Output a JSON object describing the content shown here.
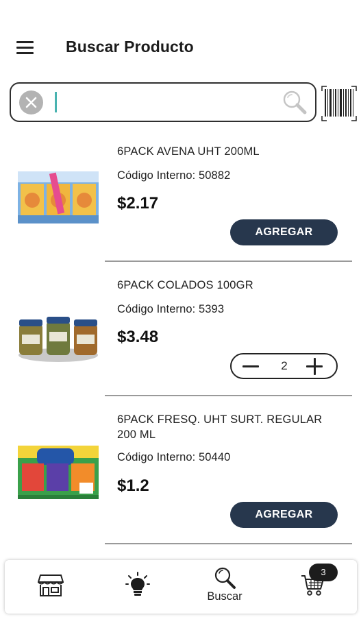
{
  "header": {
    "title": "Buscar Producto",
    "menu_icon": "hamburger-menu-icon"
  },
  "search": {
    "value": "",
    "placeholder": "",
    "clear_icon": "clear-x-icon",
    "search_icon": "magnifier-icon",
    "barcode_icon": "barcode-scanner-icon",
    "caret_color": "#49b3b0"
  },
  "products": [
    {
      "name": "6PACK AVENA UHT 200ML",
      "code_label": "Código Interno: 50882",
      "price": "$2.17",
      "action_label": "AGREGAR",
      "in_cart": false
    },
    {
      "name": "6PACK COLADOS 100GR",
      "code_label": "Código Interno: 5393",
      "price": "$3.48",
      "quantity": "2",
      "in_cart": true
    },
    {
      "name": "6PACK FRESQ. UHT SURT. REGULAR\n200 ML",
      "code_label": "Código Interno: 50440",
      "price": "$1.2",
      "action_label": "AGREGAR",
      "in_cart": false
    }
  ],
  "bottom_nav": {
    "items": [
      {
        "icon": "store-icon",
        "label": ""
      },
      {
        "icon": "lightbulb-icon",
        "label": ""
      },
      {
        "icon": "search-icon",
        "label": "Buscar",
        "active": true
      },
      {
        "icon": "cart-icon",
        "label": ""
      }
    ],
    "cart_count": "3"
  },
  "colors": {
    "button_bg": "#27374d",
    "button_text": "#ffffff",
    "divider": "#9a9a9a",
    "badge_bg": "#1c1c1c"
  }
}
